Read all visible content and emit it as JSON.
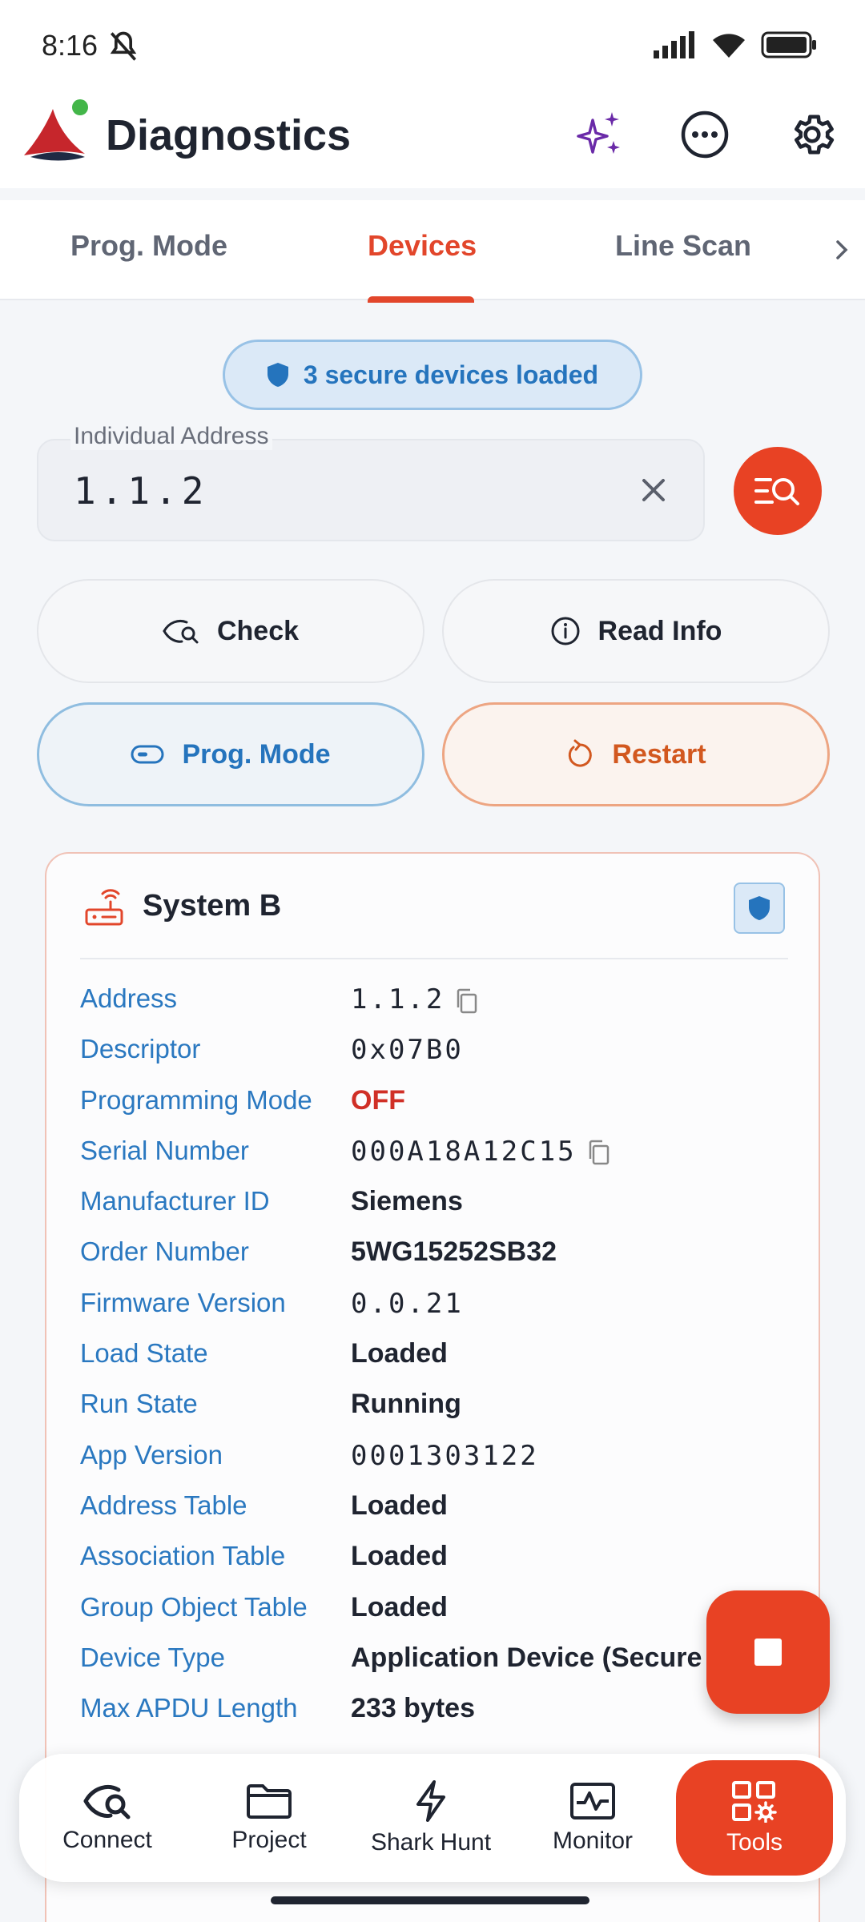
{
  "status_bar": {
    "time": "8:16"
  },
  "app_bar": {
    "title": "Diagnostics"
  },
  "tabs": [
    {
      "label": "Prog. Mode",
      "active": false
    },
    {
      "label": "Devices",
      "active": true
    },
    {
      "label": "Line Scan",
      "active": false
    }
  ],
  "banner": {
    "text": "3 secure devices loaded"
  },
  "address_field": {
    "label": "Individual Address",
    "value": "1.1.2"
  },
  "actions": {
    "check": "Check",
    "read_info": "Read Info",
    "prog_mode": "Prog. Mode",
    "restart": "Restart"
  },
  "device": {
    "title": "System B",
    "rows": [
      {
        "label": "Address",
        "value": "1.1.2"
      },
      {
        "label": "Descriptor",
        "value": "0x07B0"
      },
      {
        "label": "Programming Mode",
        "value": "OFF"
      },
      {
        "label": "Serial Number",
        "value": "000A18A12C15"
      },
      {
        "label": "Manufacturer ID",
        "value": "Siemens"
      },
      {
        "label": "Order Number",
        "value": "5WG15252SB32"
      },
      {
        "label": "Firmware Version",
        "value": "0.0.21"
      },
      {
        "label": "Load State",
        "value": "Loaded"
      },
      {
        "label": "Run State",
        "value": "Running"
      },
      {
        "label": "App Version",
        "value": "0001303122"
      },
      {
        "label": "Address Table",
        "value": "Loaded"
      },
      {
        "label": "Association Table",
        "value": "Loaded"
      },
      {
        "label": "Group Object Table",
        "value": "Loaded"
      },
      {
        "label": "Device Type",
        "value": "Application Device (Secure"
      },
      {
        "label": "Max APDU Length",
        "value": "233 bytes"
      }
    ]
  },
  "bottom_nav": [
    {
      "label": "Connect",
      "icon": "connect-eye-icon"
    },
    {
      "label": "Project",
      "icon": "folder-icon"
    },
    {
      "label": "Shark Hunt",
      "icon": "lightning-icon"
    },
    {
      "label": "Monitor",
      "icon": "monitor-icon"
    },
    {
      "label": "Tools",
      "icon": "tools-icon",
      "active": true
    }
  ],
  "colors": {
    "accent": "#e84224",
    "blue": "#2a78c0",
    "off_red": "#d02f26",
    "restart_orange": "#d2581f"
  }
}
